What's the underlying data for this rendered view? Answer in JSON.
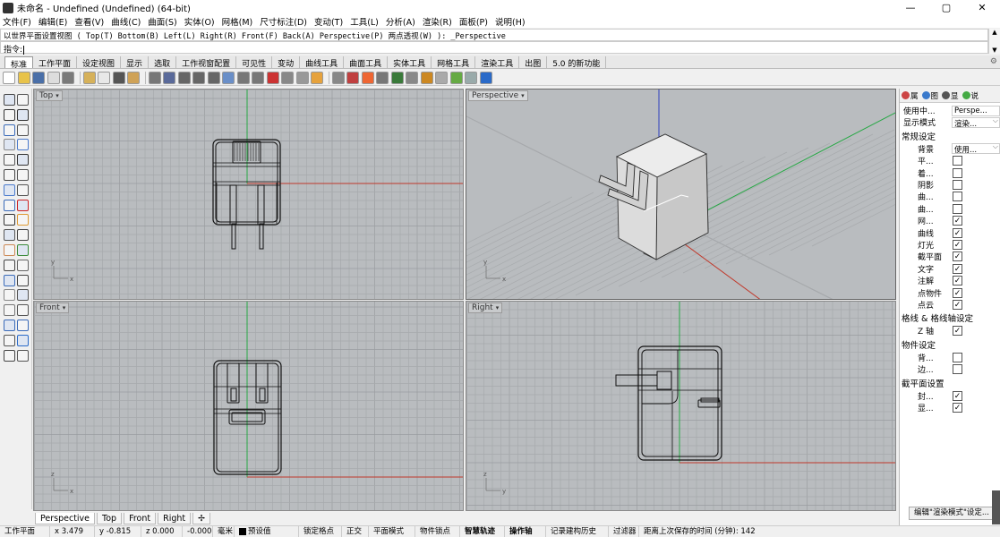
{
  "window": {
    "title": "未命名 - Undefined (Undefined) (64-bit)",
    "min": "—",
    "max": "▢",
    "close": "✕"
  },
  "menu": [
    "文件(F)",
    "编辑(E)",
    "查看(V)",
    "曲线(C)",
    "曲面(S)",
    "实体(O)",
    "网格(M)",
    "尺寸标注(D)",
    "变动(T)",
    "工具(L)",
    "分析(A)",
    "渲染(R)",
    "面板(P)",
    "说明(H)"
  ],
  "command": {
    "history": "以世界平面设置视图 ( Top(T)  Bottom(B)  Left(L)  Right(R)  Front(F)  Back(A)  Perspective(P)  两点透视(W) ): _Perspective",
    "prompt": "指令:",
    "value": ""
  },
  "tabs": [
    "标准",
    "工作平面",
    "设定视图",
    "显示",
    "选取",
    "工作视窗配置",
    "可见性",
    "变动",
    "曲线工具",
    "曲面工具",
    "实体工具",
    "网格工具",
    "渲染工具",
    "出图",
    "5.0 的新功能"
  ],
  "active_tab": 0,
  "viewports": {
    "top": {
      "label": "Top"
    },
    "perspective": {
      "label": "Perspective"
    },
    "front": {
      "label": "Front"
    },
    "right": {
      "label": "Right"
    }
  },
  "viewport_tabs": [
    "Perspective",
    "Top",
    "Front",
    "Right",
    "✢"
  ],
  "axis_labels": {
    "x": "x",
    "y": "y",
    "z": "z"
  },
  "status": {
    "cplane": "工作平面",
    "x": "x 3.479",
    "y": "y -0.815",
    "z": "z 0.000",
    "extra": "-0.000",
    "unit": "毫米",
    "layer": "预设值",
    "toggles": [
      "锁定格点",
      "正交",
      "平面模式",
      "物件锁点",
      "智慧轨迹",
      "操作轴",
      "记录建构历史",
      "过滤器"
    ],
    "bold_toggles": [
      "智慧轨迹",
      "操作轴"
    ],
    "autosave": "距离上次保存的时间 (分钟): 142"
  },
  "panel": {
    "tabs": [
      "属",
      "图",
      "显",
      "说"
    ],
    "rows": [
      {
        "label": "使用中...",
        "value": "Perspe..."
      },
      {
        "label": "显示模式",
        "value": "渲染...",
        "dropdown": true
      }
    ],
    "sections": [
      {
        "title": "常规设定",
        "rows": [
          {
            "label": "背景",
            "value": "使用...",
            "dropdown": true
          },
          {
            "label": "平...",
            "checked": false
          },
          {
            "label": "着...",
            "checked": false
          },
          {
            "label": "阴影",
            "checked": false
          },
          {
            "label": "曲...",
            "checked": false
          },
          {
            "label": "曲...",
            "checked": false
          },
          {
            "label": "网...",
            "checked": true
          },
          {
            "label": "曲线",
            "checked": true
          },
          {
            "label": "灯光",
            "checked": true
          },
          {
            "label": "截平面",
            "checked": true
          },
          {
            "label": "文字",
            "checked": true
          },
          {
            "label": "注解",
            "checked": true
          },
          {
            "label": "点物件",
            "checked": true
          },
          {
            "label": "点云",
            "checked": true
          }
        ]
      },
      {
        "title": "格线 & 格线轴设定",
        "rows": [
          {
            "label": "Z 轴",
            "checked": true
          }
        ]
      },
      {
        "title": "物件设定",
        "rows": [
          {
            "label": "背...",
            "checked": false
          },
          {
            "label": "边...",
            "checked": false
          }
        ]
      },
      {
        "title": "截平面设置",
        "rows": [
          {
            "label": "封...",
            "checked": true
          },
          {
            "label": "显...",
            "checked": true
          }
        ]
      }
    ],
    "edit_button": "编辑\"渲染模式\"设定..."
  },
  "colors": {
    "x_axis": "#c0392b",
    "y_axis": "#27a845",
    "z_axis": "#2e3fbf",
    "grid_bg": "#b9bcbf",
    "grid_line": "#a7aaad",
    "grid_major": "#9a9da0"
  }
}
